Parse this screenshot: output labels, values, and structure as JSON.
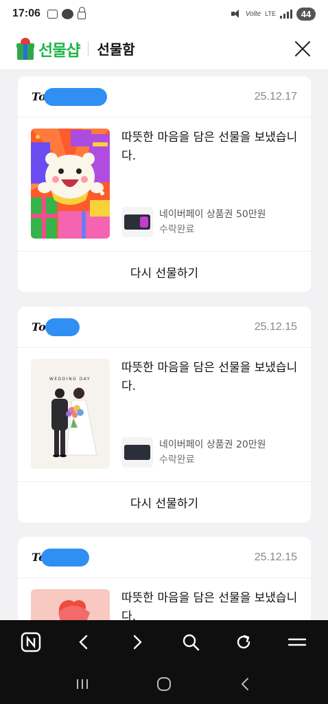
{
  "status_bar": {
    "time": "17:06",
    "left_icons": [
      "screenshot-icon",
      "talk-icon",
      "lock-icon"
    ],
    "volte": "Volte",
    "network": "LTE",
    "battery": "44"
  },
  "header": {
    "brand": "선물샵",
    "title": "선물함",
    "brand_color": "#1fb64b"
  },
  "gifts": [
    {
      "to_prefix": "To.",
      "date": "25.12.17",
      "message": "따뜻한 마음을 담은 선물을 보냈습니다.",
      "product_name": "네이버페이 상품권 50만원",
      "status": "수락완료",
      "regift_label": "다시 선물하기",
      "thumbnail": "bear-with-gifts-illustration"
    },
    {
      "to_prefix": "To.",
      "date": "25.12.15",
      "message": "따뜻한 마음을 담은 선물을 보냈습니다.",
      "product_name": "네이버페이 상품권 20만원",
      "status": "수락완료",
      "regift_label": "다시 선물하기",
      "thumbnail": "wedding-couple-illustration",
      "thumbnail_text": "WEDDING DAY"
    },
    {
      "to_prefix": "To.",
      "date": "25.12.15",
      "message": "따뜻한 마음을 담은 선물을 보냈습니다.",
      "thumbnail": "pink-gift-illustration"
    }
  ],
  "browser_bar": {
    "buttons": [
      "naver-home-icon",
      "back-icon",
      "forward-icon",
      "search-icon",
      "refresh-icon",
      "menu-icon"
    ]
  },
  "system_nav": {
    "buttons": [
      "recent-apps-icon",
      "home-icon",
      "back-icon"
    ]
  }
}
